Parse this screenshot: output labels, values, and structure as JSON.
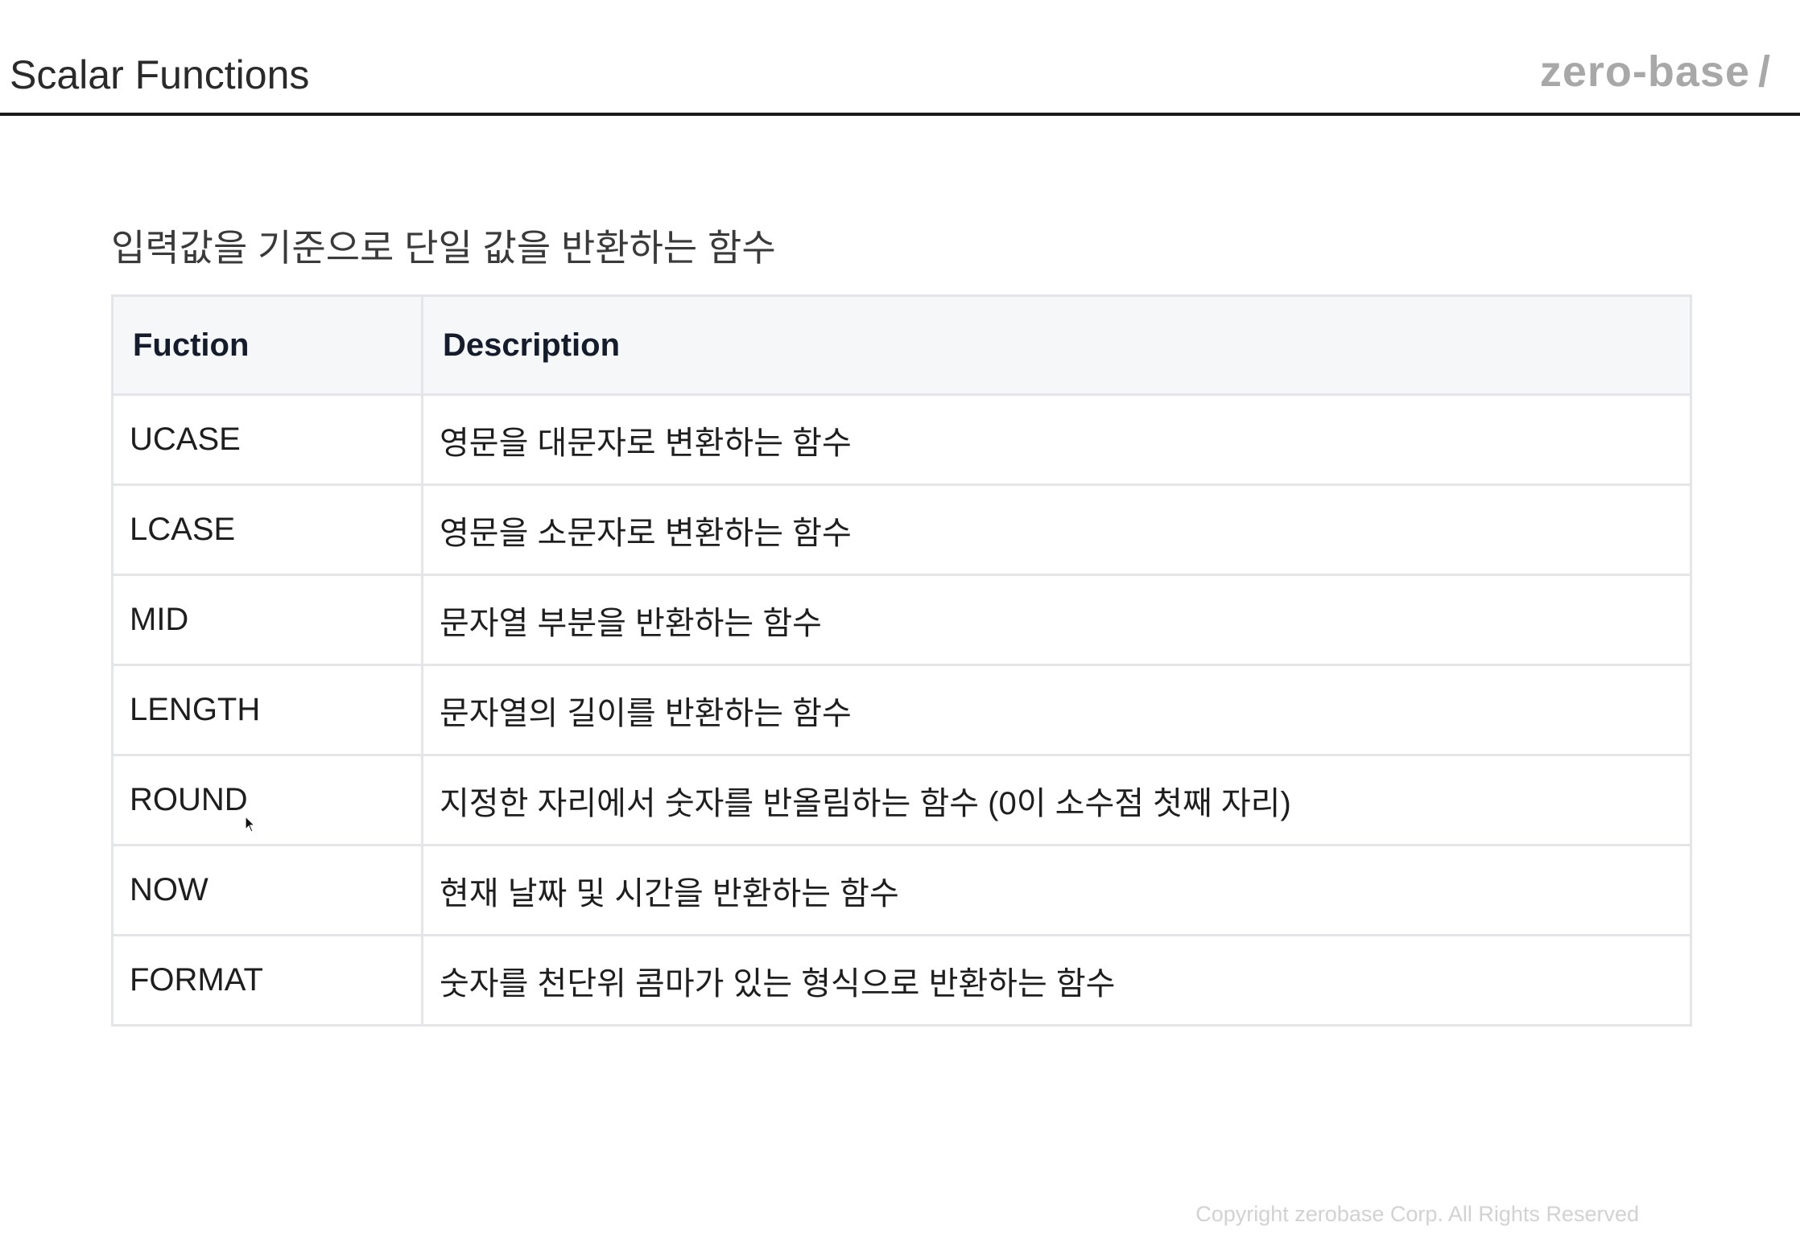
{
  "header": {
    "title": "Scalar Functions",
    "brand": "zero-base",
    "brand_slash": "/"
  },
  "subtitle": "입력값을 기준으로 단일 값을 반환하는 함수",
  "table": {
    "headers": [
      "Fuction",
      "Description"
    ],
    "rows": [
      {
        "function": "UCASE",
        "description": "영문을 대문자로 변환하는 함수"
      },
      {
        "function": "LCASE",
        "description": "영문을 소문자로 변환하는 함수"
      },
      {
        "function": "MID",
        "description": "문자열 부분을 반환하는 함수"
      },
      {
        "function": "LENGTH",
        "description": "문자열의 길이를 반환하는 함수"
      },
      {
        "function": "ROUND",
        "description": "지정한 자리에서 숫자를 반올림하는 함수 (0이 소수점 첫째 자리)"
      },
      {
        "function": "NOW",
        "description": "현재 날짜 및 시간을 반환하는 함수"
      },
      {
        "function": "FORMAT",
        "description": "숫자를 천단위 콤마가 있는 형식으로 반환하는 함수"
      }
    ]
  },
  "footer": {
    "copyright": "Copyright zerobase Corp. All Rights Reserved"
  },
  "cursor": {
    "icon": "mouse-pointer-icon"
  }
}
